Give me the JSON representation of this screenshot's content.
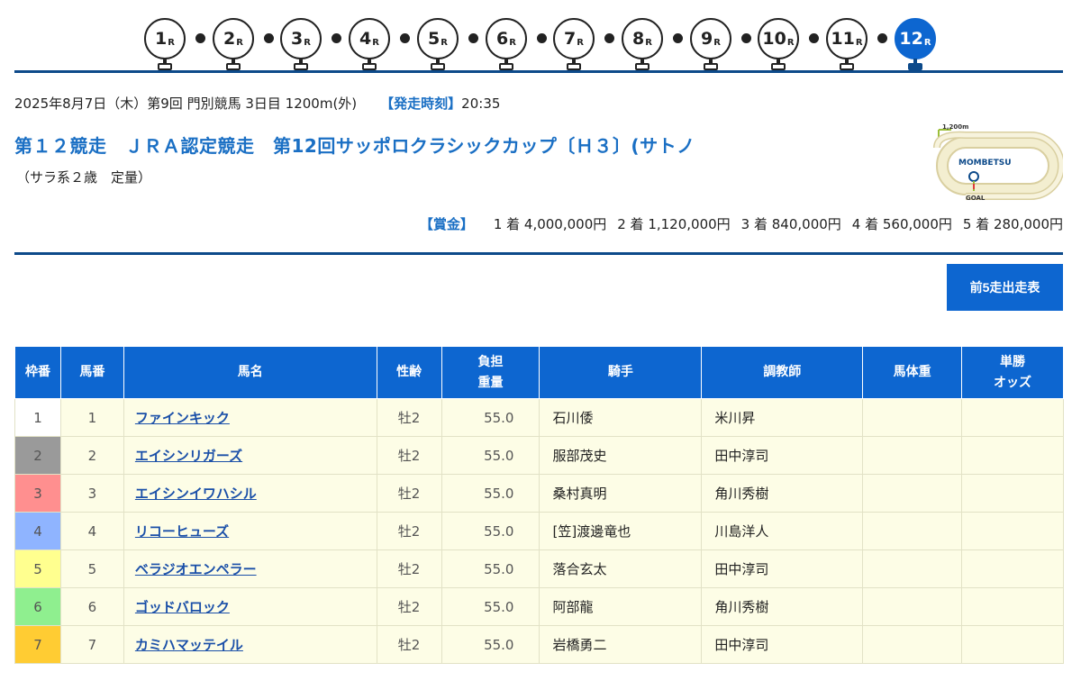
{
  "races": [
    {
      "num": "1",
      "suffix": "R",
      "active": false
    },
    {
      "num": "2",
      "suffix": "R",
      "active": false
    },
    {
      "num": "3",
      "suffix": "R",
      "active": false
    },
    {
      "num": "4",
      "suffix": "R",
      "active": false
    },
    {
      "num": "5",
      "suffix": "R",
      "active": false
    },
    {
      "num": "6",
      "suffix": "R",
      "active": false
    },
    {
      "num": "7",
      "suffix": "R",
      "active": false
    },
    {
      "num": "8",
      "suffix": "R",
      "active": false
    },
    {
      "num": "9",
      "suffix": "R",
      "active": false
    },
    {
      "num": "10",
      "suffix": "R",
      "active": false
    },
    {
      "num": "11",
      "suffix": "R",
      "active": false
    },
    {
      "num": "12",
      "suffix": "R",
      "active": true
    }
  ],
  "race": {
    "meta": "2025年8月7日（木）第9回 門別競馬 3日目 1200m(外)",
    "start_label": "【発走時刻】",
    "start_time": "20:35",
    "title": "第１２競走　ＪＲＡ認定競走　第12回サッポロクラシックカップ〔Ｈ３〕(サトノ",
    "conditions": "（サラ系２歳　定量）",
    "course_map": {
      "distance_label": "1,200m",
      "course_name": "MOMBETSU",
      "goal_label": "GOAL"
    }
  },
  "prize": {
    "label": "【賞金】",
    "items": [
      "1 着 4,000,000円",
      "2 着 1,120,000円",
      "3 着 840,000円",
      "4 着 560,000円",
      "5 着 280,000円"
    ]
  },
  "past_button": "前5走出走表",
  "table": {
    "headers": {
      "waku": "枠番",
      "umaban": "馬番",
      "name": "馬名",
      "sex_age": "性齢",
      "weight_1": "負担",
      "weight_2": "重量",
      "jockey": "騎手",
      "trainer": "調教師",
      "body_weight": "馬体重",
      "odds_1": "単勝",
      "odds_2": "オッズ"
    },
    "rows": [
      {
        "waku": "1",
        "waku_color": "#ffffff",
        "umaban": "1",
        "name": "ファインキック",
        "sex_age": "牡2",
        "weight": "55.0",
        "jockey": "石川倭",
        "trainer": "米川昇",
        "body_weight": "",
        "odds": ""
      },
      {
        "waku": "2",
        "waku_color": "#9a9a9a",
        "umaban": "2",
        "name": "エイシンリガーズ",
        "sex_age": "牡2",
        "weight": "55.0",
        "jockey": "服部茂史",
        "trainer": "田中淳司",
        "body_weight": "",
        "odds": ""
      },
      {
        "waku": "3",
        "waku_color": "#ff8f8f",
        "umaban": "3",
        "name": "エイシンイワハシル",
        "sex_age": "牡2",
        "weight": "55.0",
        "jockey": "桑村真明",
        "trainer": "角川秀樹",
        "body_weight": "",
        "odds": ""
      },
      {
        "waku": "4",
        "waku_color": "#8fb4ff",
        "umaban": "4",
        "name": "リコーヒューズ",
        "sex_age": "牡2",
        "weight": "55.0",
        "jockey": "[笠]渡邊竜也",
        "trainer": "川島洋人",
        "body_weight": "",
        "odds": ""
      },
      {
        "waku": "5",
        "waku_color": "#ffff8f",
        "umaban": "5",
        "name": "ベラジオエンペラー",
        "sex_age": "牡2",
        "weight": "55.0",
        "jockey": "落合玄太",
        "trainer": "田中淳司",
        "body_weight": "",
        "odds": ""
      },
      {
        "waku": "6",
        "waku_color": "#8fef8f",
        "umaban": "6",
        "name": "ゴッドバロック",
        "sex_age": "牡2",
        "weight": "55.0",
        "jockey": "阿部龍",
        "trainer": "角川秀樹",
        "body_weight": "",
        "odds": ""
      },
      {
        "waku": "7",
        "waku_color": "#ffcc33",
        "umaban": "7",
        "name": "カミハマッテイル",
        "sex_age": "牡2",
        "weight": "55.0",
        "jockey": "岩橋勇二",
        "trainer": "田中淳司",
        "body_weight": "",
        "odds": ""
      }
    ]
  }
}
